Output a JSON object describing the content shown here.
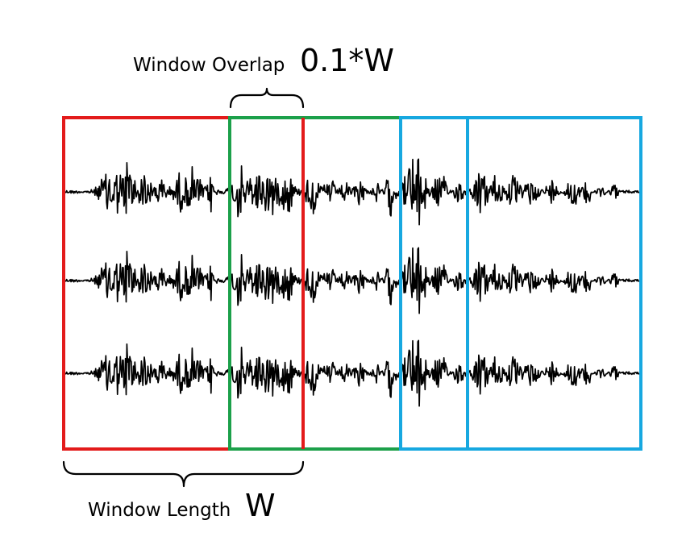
{
  "overlap_label": {
    "text": "Window Overlap",
    "value": "0.1*W"
  },
  "length_label": {
    "text": "Window Length",
    "value": "W"
  },
  "windows": [
    {
      "name": "window-1",
      "color": "#e31b1b"
    },
    {
      "name": "window-2",
      "color": "#1ca04a"
    },
    {
      "name": "window-3",
      "color": "#17a8e0"
    },
    {
      "name": "window-4",
      "color": "#17a8e0"
    }
  ],
  "waveform_rows": 3
}
